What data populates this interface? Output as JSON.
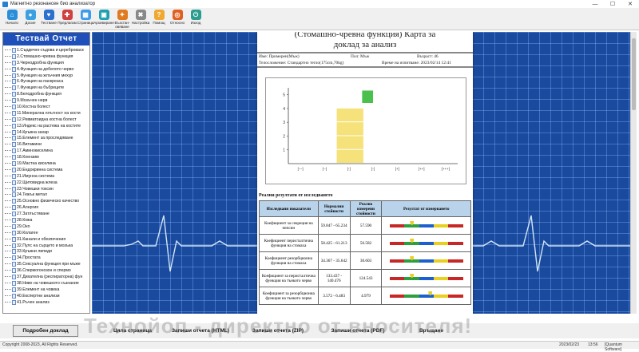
{
  "window": {
    "title": "Магнитно резонансен био анализатор",
    "min": "—",
    "max": "☐",
    "close": "✕"
  },
  "toolbar": [
    {
      "label": "Начало",
      "color": "#2a8fd8",
      "glyph": "⌂"
    },
    {
      "label": "Досие",
      "color": "#3aa0e0",
      "glyph": "●"
    },
    {
      "label": "Тестване",
      "color": "#2c6fcf",
      "glyph": "♥"
    },
    {
      "label": "Предлагам",
      "color": "#d04040",
      "glyph": "✚"
    },
    {
      "label": "Страница",
      "color": "#3d9be9",
      "glyph": "▦"
    },
    {
      "label": "Архивиране",
      "color": "#1fa0b0",
      "glyph": "▣"
    },
    {
      "label": "Възстан-\nовяване",
      "color": "#e07a20",
      "glyph": "✦"
    },
    {
      "label": "Настройка",
      "color": "#888888",
      "glyph": "✖"
    },
    {
      "label": "Помощ",
      "color": "#f0a830",
      "glyph": "?"
    },
    {
      "label": "Относно",
      "color": "#e06020",
      "glyph": "◎"
    },
    {
      "label": "Изход",
      "color": "#2a9d8f",
      "glyph": "⏻"
    }
  ],
  "sidebar": {
    "title": "Тествай Отчет",
    "items": [
      "1.Сърдечно-съдова и цереброваск",
      "2.Стомашно-чревна функция",
      "3.Чернодробна функция",
      "4.Функция на дебелото черво",
      "5.Функция на жлъчния мехур",
      "6.Функция на панкреаса",
      "7.Функция на бъбреците",
      "8.Белодробна функция",
      "9.Мозъчен нерв",
      "10.Костна болест",
      "11.Минерална плътност на кости",
      "12.Ревматоидна костна болест",
      "13.Индекс на растежа на костите",
      "14.Кръвна захар",
      "15.Елемент за проследяване",
      "16.Витамини",
      "17.Аминокиселина",
      "18.Коензим",
      "19.Мастна киселина",
      "20.Ендокринна система",
      "21.Имунна система",
      "22.Щитовидна жлеза",
      "23.Човешки токсин",
      "24.Тежък метал",
      "25.Основно физическо качество",
      "26.Алергия",
      "27.Затлъстяване",
      "28.Кожа",
      "29.Око",
      "30.Колаген",
      "31.Канали и обезпечения",
      "32.Пулс на сърцето и мозъка",
      "33.Кръвни липиди",
      "34.Простата",
      "35.Сексуална функция при мъже",
      "36.Спермогонозон и спермо",
      "37.Дихателна (респираторна) фун",
      "38.Ниво на човешкото съзнание",
      "39.Елемент на човека",
      "40.Експертни анализи",
      "41.Ръчен анализ"
    ]
  },
  "report": {
    "title_line1": "(Стомашно-чревна функция) Карта за",
    "title_line2": "доклад за анализ",
    "name": "Име: Примерен(Мъж)",
    "gender": "Пол: Мъж",
    "age": "Възраст: 46",
    "body": "Телосложение: Стандартно тегло(175cm,70kg)",
    "time": "Време на изпитване: 2023/02/14 12:41",
    "results_title": "Реални резултати от изследването",
    "headers": [
      "Изследвани показатели",
      "Нормални стойности",
      "Реално измерени стойности",
      "Резултат от измерването"
    ],
    "rows": [
      {
        "name": "Коефициент за секреция на пепсин",
        "normal": "59.847 - 65.234",
        "value": "57.590",
        "pos": 0.3
      },
      {
        "name": "Коефициент перисталтична функция на стомаха",
        "normal": "58.425 - 61.213",
        "value": "56.582",
        "pos": 0.3
      },
      {
        "name": "Коефициент резорбционна функция на стомаха",
        "normal": "34.367 - 35.642",
        "value": "30.603",
        "pos": 0.3
      },
      {
        "name": "Коефициент за перисталтична функция на тънкото черво",
        "normal": "133.437 - 140.476",
        "value": "124.543",
        "pos": 0.3
      },
      {
        "name": "Коефициент за резорбционна функция на тънкото черво",
        "normal": "3.572 - 6.483",
        "value": "4.979",
        "pos": 0.55
      }
    ]
  },
  "chart_data": {
    "type": "bar",
    "categories": [
      "[---]",
      "[--]",
      "[-]",
      "[-]",
      "[+]",
      "[++]",
      "[+++]"
    ],
    "ylim": [
      0,
      5
    ],
    "yticks": [
      "1",
      "2",
      "3",
      "4",
      "5"
    ],
    "bars": [
      {
        "category_index": 2,
        "value": 4,
        "color": "#f6e27a"
      },
      {
        "category_index": 3,
        "value": 5.3,
        "color": "#4cc04c"
      }
    ]
  },
  "buttons": [
    "Подробен доклад",
    "Цяла страница",
    "Запиши отчета (HTML)",
    "Запиши отчета (ZIP)",
    "Запиши отчета (PDF)",
    "Връщане"
  ],
  "watermark": "Технойоп - директно от вносителя!",
  "status": {
    "copyright": "Copyright 2008-2023, All Rights Reserved.",
    "date": "2023/02/23",
    "time": "13:56",
    "product": "[Quantum Software]"
  }
}
